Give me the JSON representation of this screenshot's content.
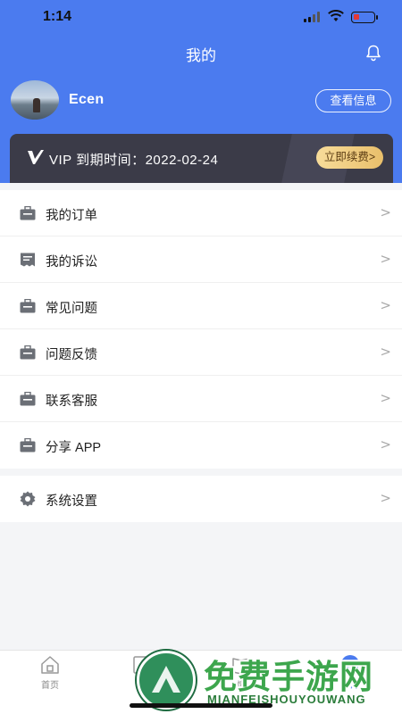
{
  "status_bar": {
    "time": "1:14"
  },
  "header": {
    "title": "我的"
  },
  "profile": {
    "username": "Ecen",
    "view_info_label": "查看信息"
  },
  "vip": {
    "label": "VIP 到期时间：2022-02-24",
    "renew_label": "立即续费>"
  },
  "menu": {
    "group1": [
      {
        "label": "我的订单",
        "icon": "briefcase-icon"
      },
      {
        "label": "我的诉讼",
        "icon": "document-icon"
      },
      {
        "label": "常见问题",
        "icon": "briefcase-icon"
      },
      {
        "label": "问题反馈",
        "icon": "briefcase-icon"
      },
      {
        "label": "联系客服",
        "icon": "briefcase-icon"
      },
      {
        "label": "分享 APP",
        "icon": "briefcase-icon"
      }
    ],
    "group2": [
      {
        "label": "系统设置",
        "icon": "gear-icon"
      }
    ],
    "chevron": ">"
  },
  "tab_bar": {
    "tabs": [
      {
        "label": "首页"
      },
      {
        "label": "我"
      },
      {
        "label": "懂"
      },
      {
        "label": "我的"
      }
    ]
  },
  "watermark": {
    "title": "免费手游网",
    "subtitle": "MIANFEISHOUYOUWANG"
  },
  "colors": {
    "header_bg": "#4b7bef",
    "vip_card_bg": "#3b3b48",
    "renew_gold": "#e9bf6b",
    "watermark_green": "#3da64d"
  }
}
